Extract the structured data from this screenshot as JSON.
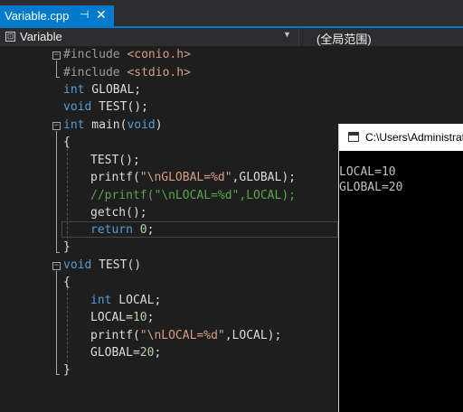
{
  "tab": {
    "title": "Variable.cpp",
    "pin_icon": "pin-icon",
    "close_glyph": "✕"
  },
  "navbar": {
    "scope": "Variable",
    "member": "(全局范围)"
  },
  "code": {
    "include1_kw": "#include ",
    "include1_hdr": "<conio.h>",
    "include2_kw": "#include ",
    "include2_hdr": "<stdio.h>",
    "l3_type": "int",
    "l3_rest": " GLOBAL;",
    "l4_type": "void",
    "l4_rest": " TEST();",
    "l5_type": "int",
    "l5_rest": " main(",
    "l5_void": "void",
    "l5_end": ")",
    "l6": "{",
    "l7": "TEST();",
    "l8_a": "printf(",
    "l8_str": "\"\\nGLOBAL=%d\"",
    "l8_b": ",GLOBAL);",
    "l9": "//printf(\"\\nLOCAL=%d\",LOCAL);",
    "l10": "getch();",
    "l11_kw": "return",
    "l11_num": "0",
    "l11_end": ";",
    "l12": "}",
    "l13_type": "void",
    "l13_rest": " TEST()",
    "l14": "{",
    "l15_type": "int",
    "l15_rest": " LOCAL;",
    "l16_a": "LOCAL=",
    "l16_num": "10",
    "l16_end": ";",
    "l17_a": "printf(",
    "l17_str": "\"\\nLOCAL=%d\"",
    "l17_b": ",LOCAL);",
    "l18_a": "GLOBAL=",
    "l18_num": "20",
    "l18_end": ";",
    "l19": "}"
  },
  "console": {
    "title": "C:\\Users\\Administrator",
    "line1": "LOCAL=10",
    "line2": "GLOBAL=20"
  }
}
